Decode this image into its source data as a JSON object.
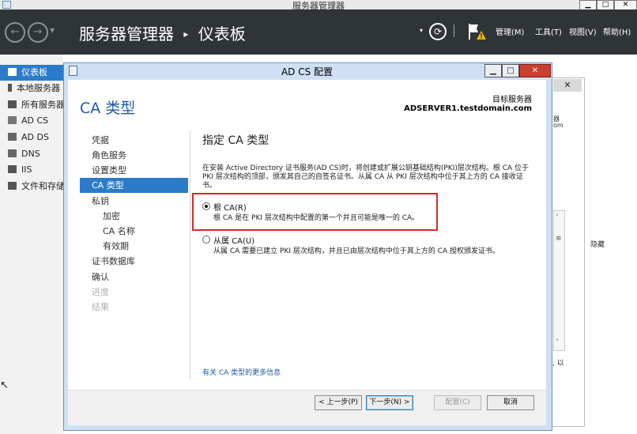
{
  "window": {
    "title": "服务器管理器",
    "minimize": "▁",
    "maximize": "□",
    "close": "✕"
  },
  "header": {
    "title": "服务器管理器",
    "breadcrumb_sep": "▸",
    "page": "仪表板",
    "refresh": "⟳",
    "menus": [
      "管理(M)",
      "工具(T)",
      "视图(V)",
      "帮助(H)"
    ]
  },
  "nav": {
    "items": [
      {
        "label": "仪表板",
        "icon": "dashboard-icon"
      },
      {
        "label": "本地服务器",
        "icon": "server-icon"
      },
      {
        "label": "所有服务器",
        "icon": "servers-icon"
      },
      {
        "label": "AD CS",
        "icon": "adcs-icon"
      },
      {
        "label": "AD DS",
        "icon": "adds-icon"
      },
      {
        "label": "DNS",
        "icon": "dns-icon"
      },
      {
        "label": "IIS",
        "icon": "iis-icon"
      },
      {
        "label": "文件和存储",
        "icon": "storage-icon"
      }
    ]
  },
  "background": {
    "close": "✕",
    "fragment_1": "器",
    "fragment_2": "om",
    "hide": "隐藏",
    "fragment_3": ", 以"
  },
  "dialog": {
    "title": "AD CS 配置",
    "heading": "CA 类型",
    "target_label": "目标服务器",
    "target_name": "ADSERVER1.testdomain.com",
    "steps": [
      {
        "label": "凭据"
      },
      {
        "label": "角色服务"
      },
      {
        "label": "设置类型"
      },
      {
        "label": "CA 类型"
      },
      {
        "label": "私钥"
      },
      {
        "label": "加密"
      },
      {
        "label": "CA 名称"
      },
      {
        "label": "有效期"
      },
      {
        "label": "证书数据库"
      },
      {
        "label": "确认"
      },
      {
        "label": "进度"
      },
      {
        "label": "结果"
      }
    ],
    "section_title": "指定 CA 类型",
    "description": "在安装 Active Directory 证书服务(AD CS)时，将创建或扩展公钥基础结构(PKI)层次结构。根 CA 位于 PKI 层次结构的顶部，颁发其自己的自签名证书。从属 CA 从 PKI 层次结构中位于其上方的 CA 接收证书。",
    "options": [
      {
        "label": "根 CA(R)",
        "desc": "根 CA 是在 PKI 层次结构中配置的第一个并且可能是唯一的 CA。",
        "selected": true
      },
      {
        "label": "从属 CA(U)",
        "desc": "从属 CA 需要已建立 PKI 层次结构，并且已由层次结构中位于其上方的 CA 授权颁发证书。",
        "selected": false
      }
    ],
    "more_link": "有关 CA 类型的更多信息",
    "buttons": {
      "prev": "< 上一步(P)",
      "next": "下一步(N) >",
      "configure": "配置(C)",
      "cancel": "取消"
    }
  }
}
